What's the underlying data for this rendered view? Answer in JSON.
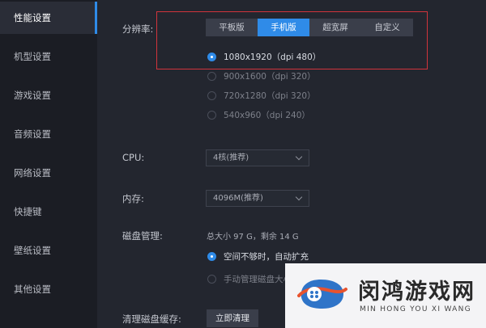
{
  "sidebar": {
    "items": [
      {
        "label": "性能设置",
        "active": true
      },
      {
        "label": "机型设置"
      },
      {
        "label": "游戏设置"
      },
      {
        "label": "音频设置"
      },
      {
        "label": "网络设置"
      },
      {
        "label": "快捷键"
      },
      {
        "label": "壁纸设置"
      },
      {
        "label": "其他设置"
      }
    ]
  },
  "resolution": {
    "label": "分辨率:",
    "tabs": [
      "平板版",
      "手机版",
      "超宽屏",
      "自定义"
    ],
    "selected_tab": "手机版",
    "options": [
      {
        "label": "1080x1920（dpi 480）",
        "checked": true
      },
      {
        "label": "900x1600（dpi 320）"
      },
      {
        "label": "720x1280（dpi 320）"
      },
      {
        "label": "540x960（dpi 240）"
      }
    ]
  },
  "cpu": {
    "label": "CPU:",
    "value": "4核(推荐)"
  },
  "memory": {
    "label": "内存:",
    "value": "4096M(推荐)"
  },
  "disk": {
    "label": "磁盘管理:",
    "info": "总大小 97 G，剩余 14 G",
    "options": [
      {
        "label": "空间不够时，自动扩充",
        "checked": true
      },
      {
        "label": "手动管理磁盘大小"
      }
    ]
  },
  "cache": {
    "label": "清理磁盘缓存:",
    "button": "立即清理"
  },
  "watermark": {
    "title": "闵鸿游戏网",
    "subtitle": "MIN HONG YOU XI WANG"
  },
  "colors": {
    "accent": "#2f8be8",
    "sidebar_bg": "#1b1d24",
    "main_bg": "#23262f",
    "highlight": "#d1343c"
  }
}
